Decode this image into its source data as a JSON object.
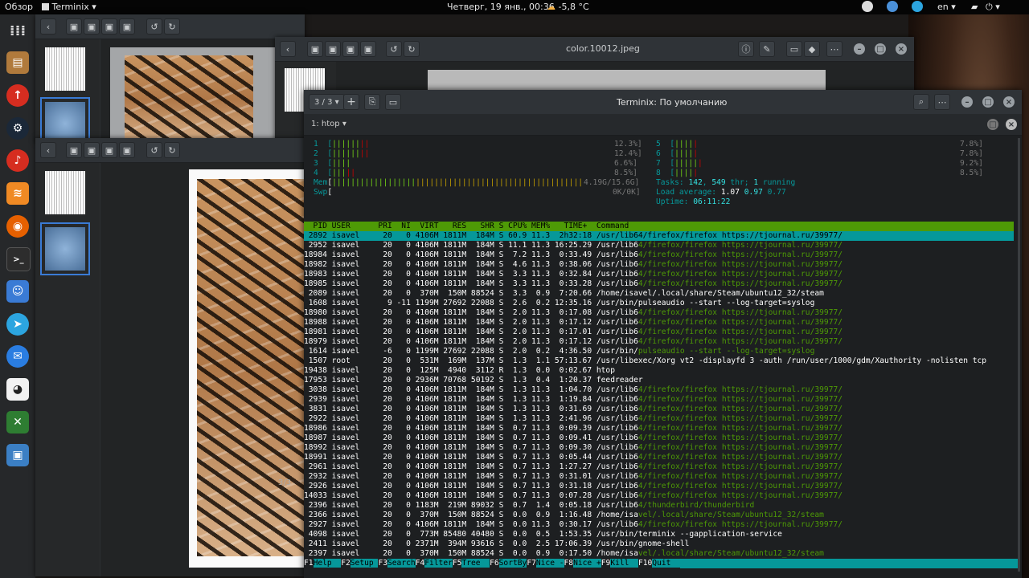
{
  "topbar": {
    "overview": "Обзор",
    "app": "Terminix",
    "clock": "Четверг, 19 янв., 00:36",
    "weather": "-5,8 °C",
    "lang": "en"
  },
  "viewer": {
    "title": "color.10012.jpeg"
  },
  "term": {
    "tab_counter": "3 / 3",
    "title": "Terminix: По умолчанию",
    "session": "1: htop",
    "sidebar_counter": "3/3"
  },
  "htop": {
    "cpus": [
      {
        "n": "1",
        "bar": "||||||",
        "bar2": "||",
        "pct": "12.3%]"
      },
      {
        "n": "2",
        "bar": "||||||",
        "bar2": "||",
        "pct": "12.4%]"
      },
      {
        "n": "3",
        "bar": "||||",
        "bar2": "",
        "pct": "6.6%]"
      },
      {
        "n": "4",
        "bar": "|||",
        "bar2": "||",
        "pct": "8.5%]"
      },
      {
        "n": "5",
        "bar": "||||",
        "bar2": "|",
        "pct": "7.8%]"
      },
      {
        "n": "6",
        "bar": "||||",
        "bar2": "|",
        "pct": "7.8%]"
      },
      {
        "n": "7",
        "bar": "|||||",
        "bar2": "|",
        "pct": "9.2%]"
      },
      {
        "n": "8",
        "bar": "||||",
        "bar2": "|",
        "pct": "8.5%]"
      }
    ],
    "mem_label": "Mem",
    "mem_bar": "||||||||||||||||||||||||||||||||||||||||||||||||||||||",
    "mem_val": "4.19G/15.6G]",
    "swp_label": "Swp",
    "swp_val": "0K/0K]",
    "tasks": "Tasks: ",
    "tasks_n": "142",
    "thr": "549",
    "running": "1",
    "load_label": "Load average: ",
    "load1": "1.07",
    "load5": "0.97",
    "load15": "0.77",
    "uptime_label": "Uptime: ",
    "uptime": "06:11:22",
    "header": "  PID USER      PRI  NI  VIRT   RES   SHR S CPU% MEM%   TIME+  Command",
    "rows": [
      {
        "t": " 2892 isavel     20   0 4106M 1811M  184M S 60.9 11.3  2h32:18 /usr/lib64/firefox/firefox https://tjournal.ru/39977/",
        "c": "sel"
      },
      {
        "t": " 2952 isavel     20   0 4106M 1811M  184M S 11.1 11.3 16:25.29 /usr/lib64/firefox/firefox https://tjournal.ru/39977/",
        "c": "ff"
      },
      {
        "t": "18984 isavel     20   0 4106M 1811M  184M S  7.2 11.3  0:33.49 /usr/lib64/firefox/firefox https://tjournal.ru/39977/",
        "c": "ff"
      },
      {
        "t": "18982 isavel     20   0 4106M 1811M  184M S  4.6 11.3  0:38.06 /usr/lib64/firefox/firefox https://tjournal.ru/39977/",
        "c": "ff"
      },
      {
        "t": "18983 isavel     20   0 4106M 1811M  184M S  3.3 11.3  0:32.84 /usr/lib64/firefox/firefox https://tjournal.ru/39977/",
        "c": "ff"
      },
      {
        "t": "18985 isavel     20   0 4106M 1811M  184M S  3.3 11.3  0:33.28 /usr/lib64/firefox/firefox https://tjournal.ru/39977/",
        "c": "ff"
      },
      {
        "t": " 2089 isavel     20   0  370M  150M 88524 S  3.3  0.9  7:20.66 /home/isavel/.local/share/Steam/ubuntu12_32/steam",
        "c": "w"
      },
      {
        "t": " 1608 isavel      9 -11 1199M 27692 22088 S  2.6  0.2 12:35.16 /usr/bin/pulseaudio --start --log-target=syslog",
        "c": "w"
      },
      {
        "t": "18980 isavel     20   0 4106M 1811M  184M S  2.0 11.3  0:17.08 /usr/lib64/firefox/firefox https://tjournal.ru/39977/",
        "c": "ff"
      },
      {
        "t": "18988 isavel     20   0 4106M 1811M  184M S  2.0 11.3  0:17.12 /usr/lib64/firefox/firefox https://tjournal.ru/39977/",
        "c": "ff"
      },
      {
        "t": "18981 isavel     20   0 4106M 1811M  184M S  2.0 11.3  0:17.01 /usr/lib64/firefox/firefox https://tjournal.ru/39977/",
        "c": "ff"
      },
      {
        "t": "18979 isavel     20   0 4106M 1811M  184M S  2.0 11.3  0:17.12 /usr/lib64/firefox/firefox https://tjournal.ru/39977/",
        "c": "ff"
      },
      {
        "t": " 1614 isavel     -6   0 1199M 27692 22088 S  2.0  0.2  4:36.50 /usr/bin/pulseaudio --start --log-target=syslog",
        "c": "ff"
      },
      {
        "t": " 1507 root       20   0  531M  169M  137M S  1.3  1.1 57:13.67 /usr/libexec/Xorg vt2 -displayfd 3 -auth /run/user/1000/gdm/Xauthority -nolisten tcp",
        "c": "w"
      },
      {
        "t": "19438 isavel     20   0  125M  4940  3112 R  1.3  0.0  0:02.67 htop",
        "c": "w"
      },
      {
        "t": "17953 isavel     20   0 2936M 70768 50192 S  1.3  0.4  1:20.37 feedreader",
        "c": "w"
      },
      {
        "t": " 3038 isavel     20   0 4106M 1811M  184M S  1.3 11.3  1:04.70 /usr/lib64/firefox/firefox https://tjournal.ru/39977/",
        "c": "ff"
      },
      {
        "t": " 2939 isavel     20   0 4106M 1811M  184M S  1.3 11.3  1:19.84 /usr/lib64/firefox/firefox https://tjournal.ru/39977/",
        "c": "ff"
      },
      {
        "t": " 3831 isavel     20   0 4106M 1811M  184M S  1.3 11.3  0:31.69 /usr/lib64/firefox/firefox https://tjournal.ru/39977/",
        "c": "ff"
      },
      {
        "t": " 2922 isavel     20   0 4106M 1811M  184M S  1.3 11.3  2:41.96 /usr/lib64/firefox/firefox https://tjournal.ru/39977/",
        "c": "ff"
      },
      {
        "t": "18986 isavel     20   0 4106M 1811M  184M S  0.7 11.3  0:09.39 /usr/lib64/firefox/firefox https://tjournal.ru/39977/",
        "c": "ff"
      },
      {
        "t": "18987 isavel     20   0 4106M 1811M  184M S  0.7 11.3  0:09.41 /usr/lib64/firefox/firefox https://tjournal.ru/39977/",
        "c": "ff"
      },
      {
        "t": "18992 isavel     20   0 4106M 1811M  184M S  0.7 11.3  0:09.30 /usr/lib64/firefox/firefox https://tjournal.ru/39977/",
        "c": "ff"
      },
      {
        "t": "18991 isavel     20   0 4106M 1811M  184M S  0.7 11.3  0:05.44 /usr/lib64/firefox/firefox https://tjournal.ru/39977/",
        "c": "ff"
      },
      {
        "t": " 2961 isavel     20   0 4106M 1811M  184M S  0.7 11.3  1:27.27 /usr/lib64/firefox/firefox https://tjournal.ru/39977/",
        "c": "ff"
      },
      {
        "t": " 2932 isavel     20   0 4106M 1811M  184M S  0.7 11.3  0:31.01 /usr/lib64/firefox/firefox https://tjournal.ru/39977/",
        "c": "ff"
      },
      {
        "t": " 2926 isavel     20   0 4106M 1811M  184M S  0.7 11.3  0:31.18 /usr/lib64/firefox/firefox https://tjournal.ru/39977/",
        "c": "ff"
      },
      {
        "t": "14033 isavel     20   0 4106M 1811M  184M S  0.7 11.3  0:07.28 /usr/lib64/firefox/firefox https://tjournal.ru/39977/",
        "c": "ff"
      },
      {
        "t": " 2396 isavel     20   0 1183M  219M 89032 S  0.7  1.4  0:05.18 /usr/lib64/thunderbird/thunderbird",
        "c": "ff"
      },
      {
        "t": " 2366 isavel     20   0  370M  150M 88524 S  0.0  0.9  1:16.48 /home/isavel/.local/share/Steam/ubuntu12_32/steam",
        "c": "ff"
      },
      {
        "t": " 2927 isavel     20   0 4106M 1811M  184M S  0.0 11.3  0:30.17 /usr/lib64/firefox/firefox https://tjournal.ru/39977/",
        "c": "ff"
      },
      {
        "t": " 4098 isavel     20   0  773M 85480 40480 S  0.0  0.5  1:53.35 /usr/bin/terminix --gapplication-service",
        "c": "w"
      },
      {
        "t": " 2411 isavel     20   0 2371M  394M 93616 S  0.0  2.5 17:06.39 /usr/bin/gnome-shell",
        "c": "w"
      },
      {
        "t": " 2397 isavel     20   0  370M  150M 88524 S  0.0  0.9  0:17.50 /home/isavel/.local/share/Steam/ubuntu12_32/steam",
        "c": "ff"
      }
    ],
    "fkeys": [
      {
        "k": "F1",
        "l": "Help  "
      },
      {
        "k": "F2",
        "l": "Setup "
      },
      {
        "k": "F3",
        "l": "Search"
      },
      {
        "k": "F4",
        "l": "Filter"
      },
      {
        "k": "F5",
        "l": "Tree  "
      },
      {
        "k": "F6",
        "l": "SortBy"
      },
      {
        "k": "F7",
        "l": "Nice -"
      },
      {
        "k": "F8",
        "l": "Nice +"
      },
      {
        "k": "F9",
        "l": "Kill  "
      },
      {
        "k": "F10",
        "l": "Quit  "
      }
    ]
  },
  "colors": {
    "accent": "#06989a",
    "header_green": "#4e9a06",
    "selection": "#3a7bd5"
  }
}
